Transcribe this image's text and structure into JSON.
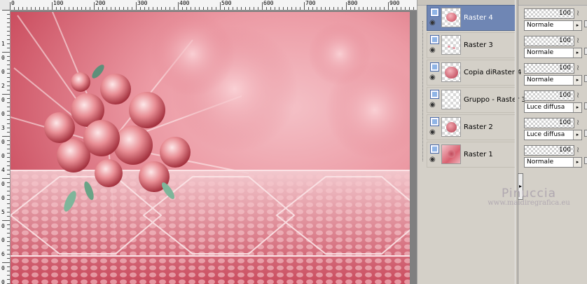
{
  "ruler": {
    "top_labels": [
      "0",
      "100",
      "200",
      "300",
      "400",
      "500",
      "600",
      "700",
      "800",
      "900"
    ],
    "left_labels": [
      "1",
      "0",
      "0",
      "2",
      "0",
      "0",
      "3",
      "0",
      "0",
      "4",
      "0",
      "0",
      "5",
      "0",
      "0",
      "6",
      "0",
      "0"
    ]
  },
  "layers": [
    {
      "name": "Raster 4",
      "selected": true,
      "opacity": "100",
      "blend": "Normale",
      "thumb": "rose-bouquet-small"
    },
    {
      "name": "Raster 3",
      "selected": false,
      "opacity": "100",
      "blend": "Normale",
      "thumb": "sparse-dots"
    },
    {
      "name": "Copia diRaster 4",
      "selected": false,
      "opacity": "100",
      "blend": "Normale",
      "thumb": "rose-bouquet"
    },
    {
      "name": "Gruppo - Raster 3",
      "selected": false,
      "opacity": "100",
      "blend": "Luce diffusa",
      "thumb": "empty"
    },
    {
      "name": "Raster 2",
      "selected": false,
      "opacity": "100",
      "blend": "Luce diffusa",
      "thumb": "rose-ball"
    },
    {
      "name": "Raster 1",
      "selected": false,
      "opacity": "100",
      "blend": "Normale",
      "thumb": "pink-background"
    }
  ],
  "watermark": {
    "name": "Pinuccia",
    "url": "www.maidiregrafica.eu"
  },
  "colors": {
    "accent_selected": "#6f86b4",
    "rose": "#d94f65",
    "panel": "#d4d0c8"
  },
  "icons": {
    "layer_type": "raster-layer-icon",
    "visibility": "eye-icon",
    "link": "link-icon",
    "lock": "lock-icon"
  }
}
